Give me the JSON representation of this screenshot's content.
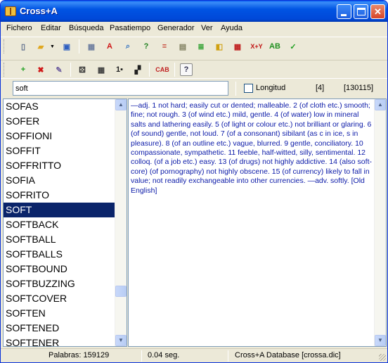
{
  "window": {
    "title": "Cross+A"
  },
  "menu": [
    "Fichero",
    "Editar",
    "Búsqueda",
    "Pasatiempo",
    "Generador",
    "Ver",
    "Ayuda"
  ],
  "toolbar1": [
    {
      "name": "new-file-icon",
      "glyph": "▯",
      "color": "#5a6a8a"
    },
    {
      "name": "open-folder-icon",
      "glyph": "▰",
      "color": "#e0a820"
    },
    {
      "name": "save-icon",
      "glyph": "▣",
      "color": "#3060c0"
    },
    {
      "name": "crossword-grid-icon",
      "glyph": "▦",
      "color": "#7080a0"
    },
    {
      "name": "font-icon",
      "glyph": "A",
      "color": "#d01818"
    },
    {
      "name": "find-icon",
      "glyph": "⌕",
      "color": "#3070c0"
    },
    {
      "name": "help-question-icon",
      "glyph": "?",
      "color": "#208020"
    },
    {
      "name": "stripes-icon",
      "glyph": "≡",
      "color": "#c03020"
    },
    {
      "name": "calculator-icon",
      "glyph": "▤",
      "color": "#808060"
    },
    {
      "name": "flag-icon",
      "glyph": "≣",
      "color": "#30a030"
    },
    {
      "name": "blocks-icon",
      "glyph": "◧",
      "color": "#d0a010"
    },
    {
      "name": "grid-icon",
      "glyph": "▦",
      "color": "#c02020"
    },
    {
      "name": "xy-icon",
      "glyph": "X+Y",
      "color": "#c01010"
    },
    {
      "name": "letters-ab-icon",
      "glyph": "AB",
      "color": "#209020"
    },
    {
      "name": "checklist-icon",
      "glyph": "✓",
      "color": "#20a020"
    }
  ],
  "toolbar2": [
    {
      "name": "add-icon",
      "glyph": "+",
      "color": "#20a020"
    },
    {
      "name": "delete-icon",
      "glyph": "✖",
      "color": "#d01818"
    },
    {
      "name": "edit-icon",
      "glyph": "✎",
      "color": "#7060a0"
    },
    {
      "name": "dice-icon",
      "glyph": "⚄",
      "color": "#303030"
    },
    {
      "name": "table-icon",
      "glyph": "▦",
      "color": "#404040"
    },
    {
      "name": "number-grid-icon",
      "glyph": "1▪",
      "color": "#202020"
    },
    {
      "name": "checker-icon",
      "glyph": "▞",
      "color": "#202020"
    },
    {
      "name": "cab-icon",
      "glyph": "CAB",
      "color": "#c02020"
    },
    {
      "name": "help-icon",
      "glyph": "?",
      "color": "#303050"
    }
  ],
  "search": {
    "value": "soft"
  },
  "options": {
    "longitud_label": "Longitud",
    "count": "[4]",
    "total": "[130115]"
  },
  "words": [
    "SOFAS",
    "SOFER",
    "SOFFIONI",
    "SOFFIT",
    "SOFFRITTO",
    "SOFIA",
    "SOFRITO",
    "SOFT",
    "SOFTBACK",
    "SOFTBALL",
    "SOFTBALLS",
    "SOFTBOUND",
    "SOFTBUZZING",
    "SOFTCOVER",
    "SOFTEN",
    "SOFTENED",
    "SOFTENER"
  ],
  "selected_word": "SOFT",
  "definition": "—adj. 1 not hard; easily cut or dented; malleable. 2 (of cloth etc.) smooth; fine; not rough. 3 (of wind etc.) mild, gentle. 4 (of water) low in mineral salts and lathering easily. 5 (of light or colour etc.) not brilliant or glaring. 6 (of sound) gentle, not loud. 7 (of a consonant) sibilant (as c in ice, s in pleasure). 8 (of an outline etc.) vague, blurred. 9 gentle, conciliatory. 10 compassionate, sympathetic. 11 feeble, half-witted, silly, sentimental. 12 colloq. (of a job etc.) easy. 13 (of drugs) not highly addictive. 14 (also soft-core) (of pornography) not highly obscene. 15 (of currency) likely to fall in value; not readily exchangeable into other currencies. —adv. softly. [Old English]",
  "status": {
    "words": "Palabras: 159129",
    "time": "0.04 seg.",
    "database": "Cross+A Database [crossa.dic]"
  }
}
